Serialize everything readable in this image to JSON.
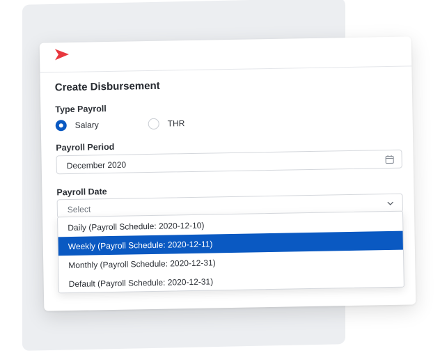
{
  "form": {
    "title": "Create Disbursement",
    "type_payroll": {
      "label": "Type Payroll",
      "options": [
        {
          "label": "Salary",
          "checked": true
        },
        {
          "label": "THR",
          "checked": false
        }
      ]
    },
    "payroll_period": {
      "label": "Payroll Period",
      "value": "December 2020",
      "icon": "calendar-icon"
    },
    "payroll_date": {
      "label": "Payroll Date",
      "placeholder": "Select",
      "icon": "chevron-down-icon",
      "options": [
        {
          "label": "Daily (Payroll Schedule: 2020-12-10)",
          "selected": false
        },
        {
          "label": "Weekly (Payroll Schedule: 2020-12-11)",
          "selected": true
        },
        {
          "label": "Monthly (Payroll Schedule: 2020-12-31)",
          "selected": false
        },
        {
          "label": "Default (Payroll Schedule: 2020-12-31)",
          "selected": false
        }
      ]
    }
  },
  "colors": {
    "accent": "#0a59c2",
    "brand": "#e8373e"
  }
}
